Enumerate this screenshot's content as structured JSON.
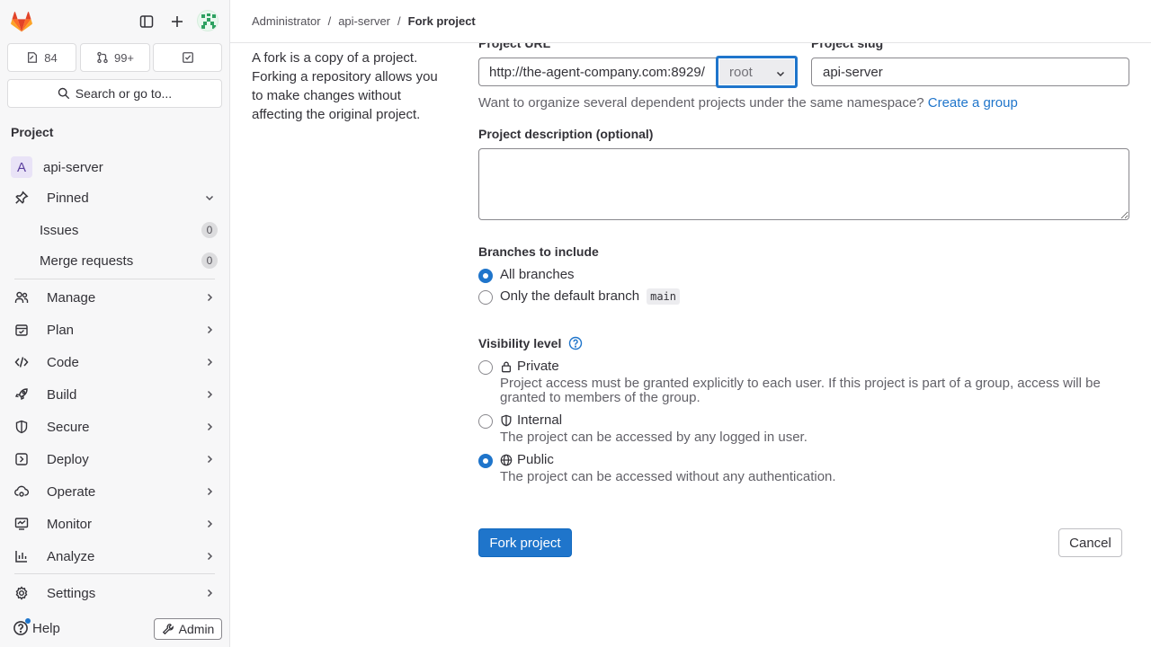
{
  "topbar": {
    "breadcrumbs": [
      "Administrator",
      "api-server",
      "Fork project"
    ]
  },
  "sidebar": {
    "counters": {
      "issues": "84",
      "merge_requests": "99+"
    },
    "search_label": "Search or go to...",
    "section_title": "Project",
    "project_name": "api-server",
    "project_initial": "A",
    "pinned_label": "Pinned",
    "pinned_items": [
      {
        "label": "Issues",
        "count": "0"
      },
      {
        "label": "Merge requests",
        "count": "0"
      }
    ],
    "items": [
      {
        "label": "Manage",
        "icon": "users-icon"
      },
      {
        "label": "Plan",
        "icon": "calendar-icon"
      },
      {
        "label": "Code",
        "icon": "code-icon"
      },
      {
        "label": "Build",
        "icon": "rocket-icon"
      },
      {
        "label": "Secure",
        "icon": "shield-icon"
      },
      {
        "label": "Deploy",
        "icon": "deploy-icon"
      },
      {
        "label": "Operate",
        "icon": "cloud-gear-icon"
      },
      {
        "label": "Monitor",
        "icon": "monitor-icon"
      },
      {
        "label": "Analyze",
        "icon": "chart-icon"
      },
      {
        "label": "Settings",
        "icon": "gear-icon"
      }
    ],
    "help_label": "Help",
    "admin_label": "Admin"
  },
  "main": {
    "description": "A fork is a copy of a project. Forking a repository allows you to make changes without affecting the original project.",
    "project_url_label": "Project URL",
    "project_url_prefix": "http://the-agent-company.com:8929/",
    "namespace_value": "root",
    "project_slug_label": "Project slug",
    "project_slug_value": "api-server",
    "group_help_text": "Want to organize several dependent projects under the same namespace?",
    "create_group_link": "Create a group",
    "description_label": "Project description (optional)",
    "branches_label": "Branches to include",
    "branch_options": {
      "all": "All branches",
      "default": "Only the default branch",
      "default_branch_name": "main",
      "selected": "all"
    },
    "visibility_label": "Visibility level",
    "visibility_options": [
      {
        "title": "Private",
        "desc": "Project access must be granted explicitly to each user. If this project is part of a group, access will be granted to members of the group.",
        "selected": false
      },
      {
        "title": "Internal",
        "desc": "The project can be accessed by any logged in user.",
        "selected": false
      },
      {
        "title": "Public",
        "desc": "The project can be accessed without any authentication.",
        "selected": true
      }
    ],
    "submit_label": "Fork project",
    "cancel_label": "Cancel"
  },
  "colors": {
    "accent": "#1f75cb",
    "sidebar_bg": "#f7f7f8"
  }
}
